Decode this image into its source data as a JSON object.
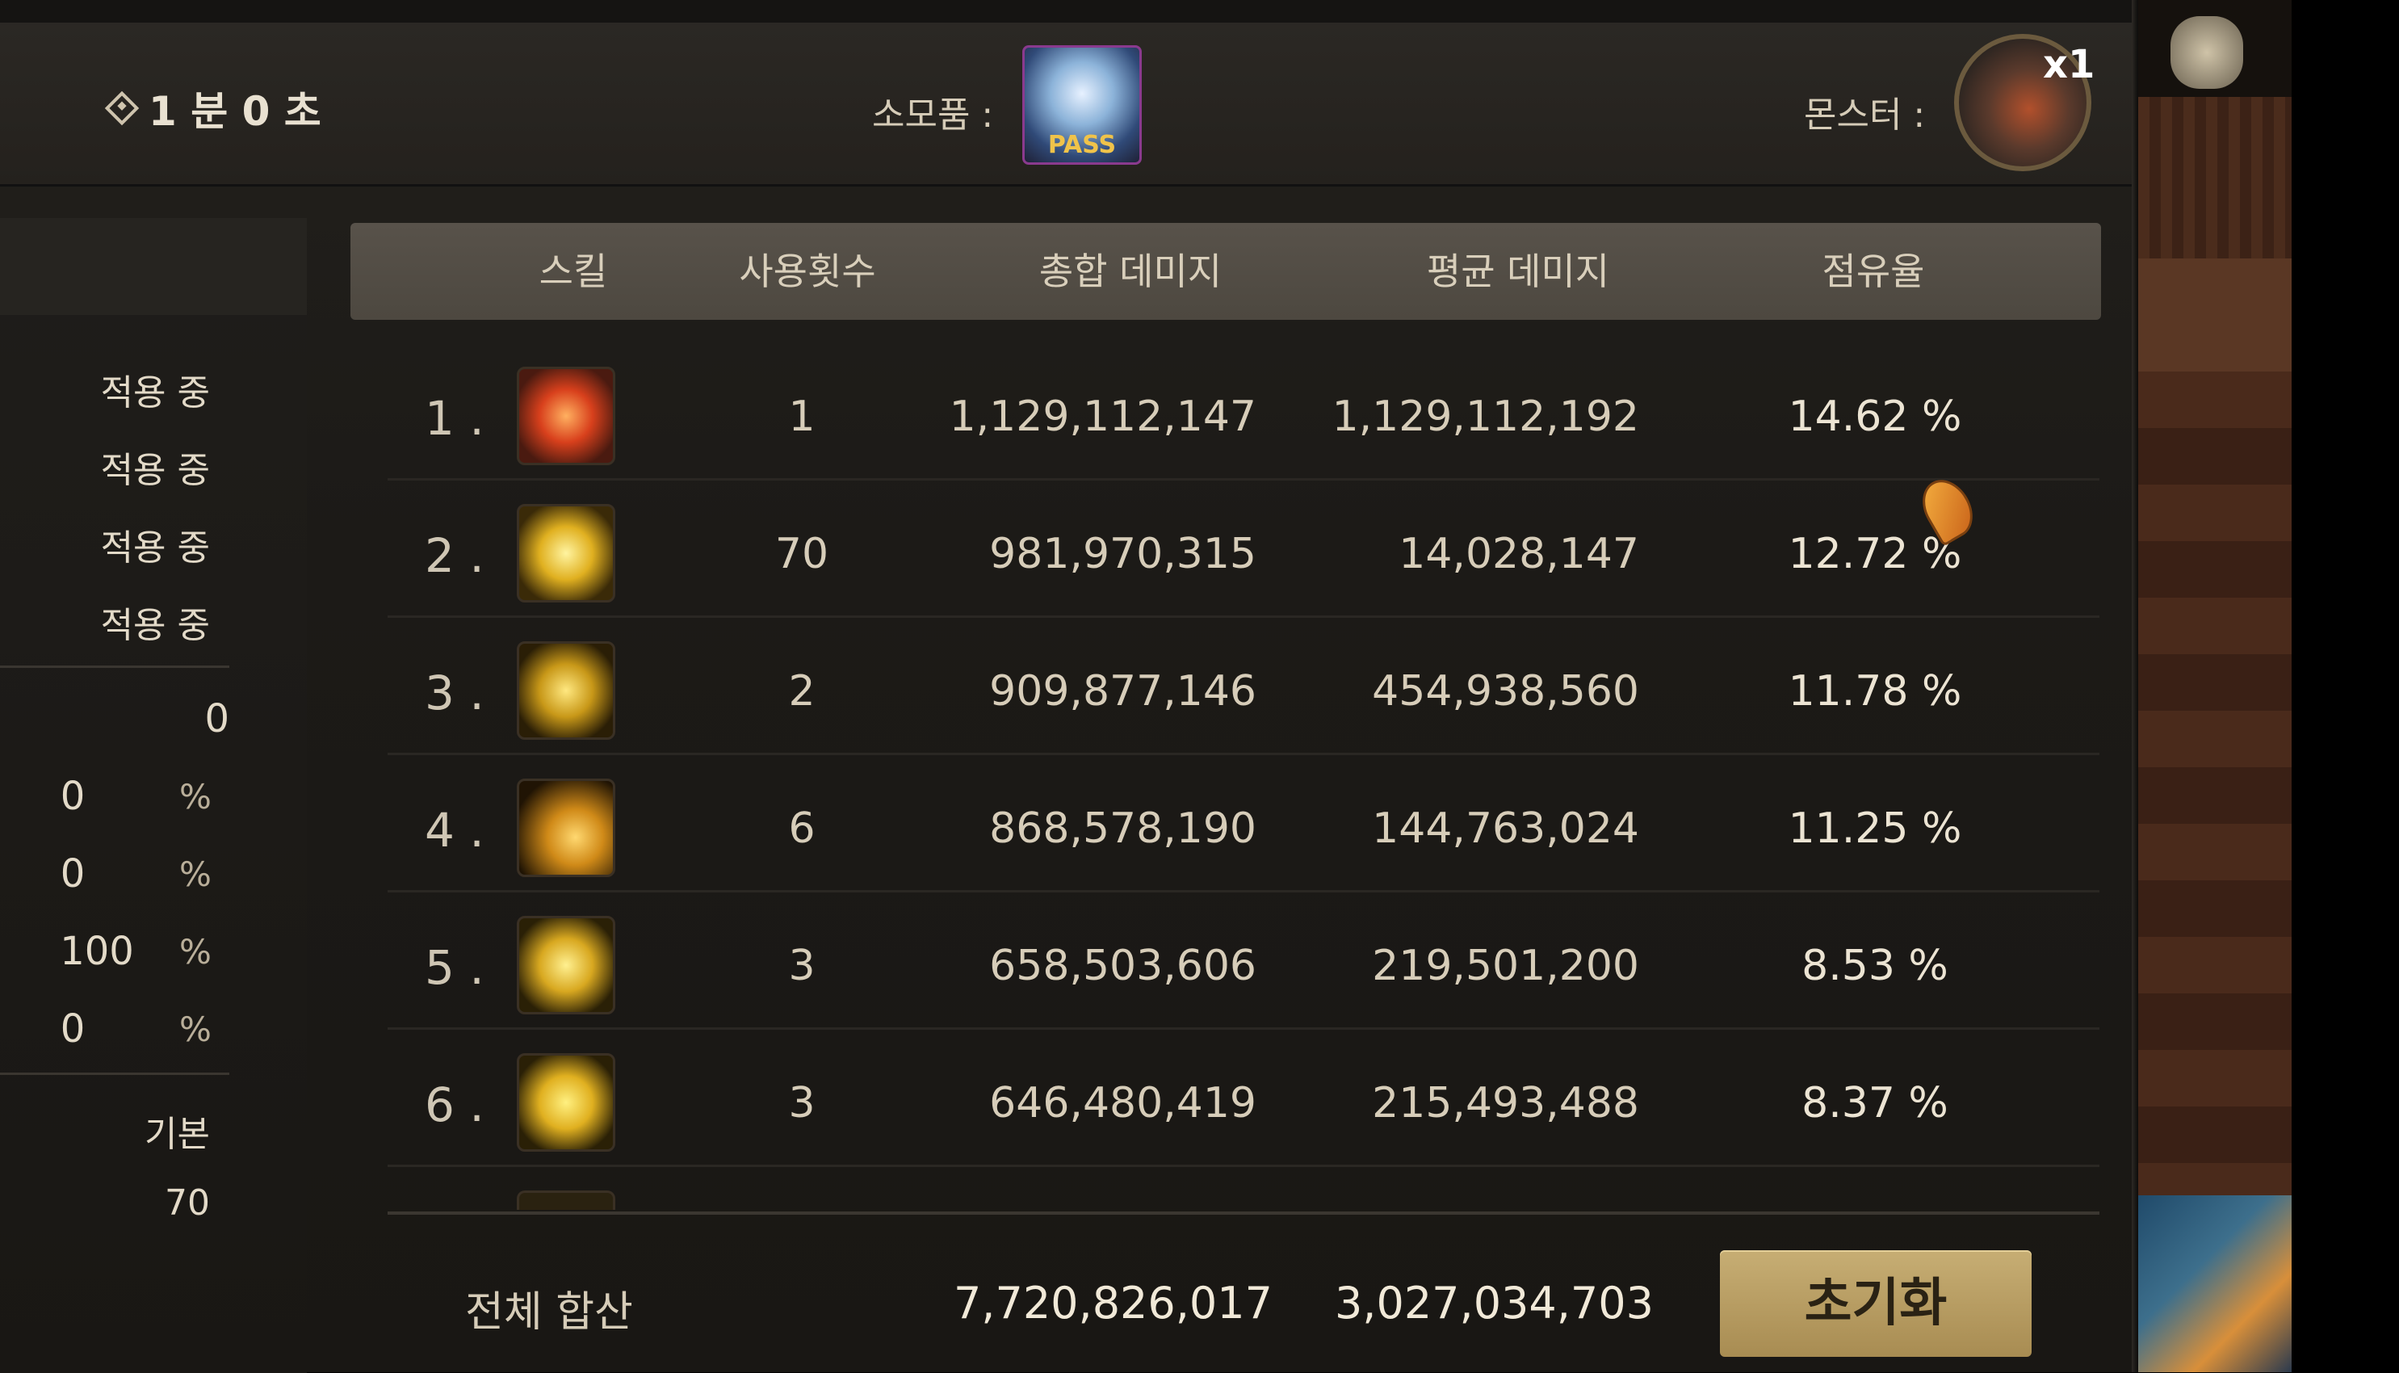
{
  "top_bar": {
    "time": "1 분 0 초",
    "consumable_label": "소모품 :",
    "pass_icon_text": "PASS",
    "monster_label": "몬스터 :",
    "monster_count": "x1"
  },
  "side_panel": {
    "status_items": [
      "적용 중",
      "적용 중",
      "적용 중",
      "적용 중"
    ],
    "value_0": "0",
    "pct_rows": [
      {
        "value": "0",
        "unit": "%"
      },
      {
        "value": "0",
        "unit": "%"
      },
      {
        "value": "100",
        "unit": "%"
      },
      {
        "value": "0",
        "unit": "%"
      }
    ],
    "mode": "기본",
    "count": "70"
  },
  "table": {
    "headers": {
      "skill": "스킬",
      "uses": "사용횟수",
      "total_damage": "총합 데미지",
      "avg_damage": "평균 데미지",
      "share": "점유율"
    },
    "rows": [
      {
        "rank": "1 .",
        "uses": "1",
        "total": "1,129,112,147",
        "avg": "1,129,112,192",
        "share": "14.62 %"
      },
      {
        "rank": "2 .",
        "uses": "70",
        "total": "981,970,315",
        "avg": "14,028,147",
        "share": "12.72 %"
      },
      {
        "rank": "3 .",
        "uses": "2",
        "total": "909,877,146",
        "avg": "454,938,560",
        "share": "11.78 %"
      },
      {
        "rank": "4 .",
        "uses": "6",
        "total": "868,578,190",
        "avg": "144,763,024",
        "share": "11.25 %"
      },
      {
        "rank": "5 .",
        "uses": "3",
        "total": "658,503,606",
        "avg": "219,501,200",
        "share": "8.53 %"
      },
      {
        "rank": "6 .",
        "uses": "3",
        "total": "646,480,419",
        "avg": "215,493,488",
        "share": "8.37 %"
      }
    ]
  },
  "footer": {
    "total_label": "전체 합산",
    "total_damage": "7,720,826,017",
    "avg_damage": "3,027,034,703",
    "reset_label": "초기화"
  }
}
